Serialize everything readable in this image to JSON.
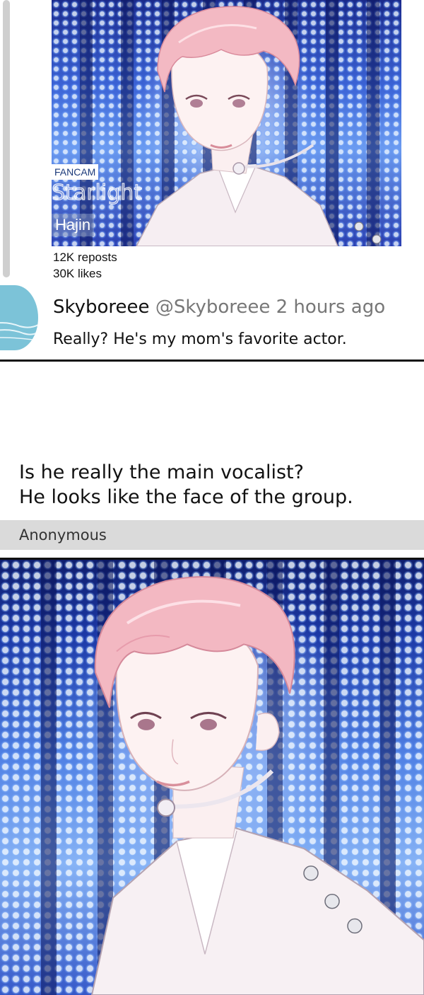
{
  "post": {
    "tag": "FANCAM",
    "title": "Starlight",
    "artist": "Hajin",
    "reposts": "12K reposts",
    "likes": "30K likes"
  },
  "comment": {
    "username": "Skyboreee",
    "handle": "@Skyboreee",
    "time": "2 hours ago",
    "text": "Really? He's my mom's favorite actor."
  },
  "question": {
    "line1": "Is he really the main vocalist?",
    "line2": "He looks like the face of the group."
  },
  "anonymous": {
    "label": "Anonymous"
  }
}
